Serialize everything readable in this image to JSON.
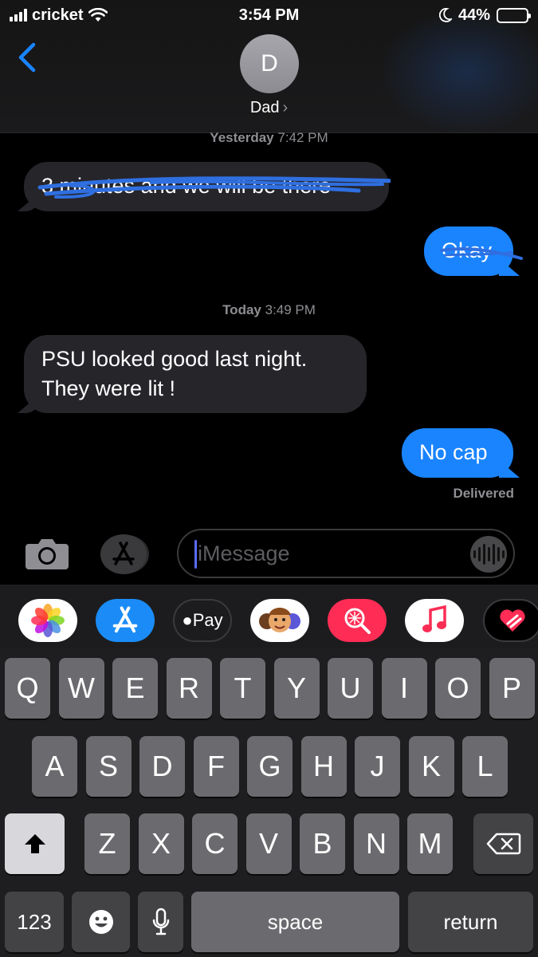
{
  "status_bar": {
    "carrier": "cricket",
    "time": "3:54 PM",
    "battery": "44%"
  },
  "header": {
    "avatar_initial": "D",
    "contact_name": "Dad",
    "chevron": "›"
  },
  "conversation": {
    "timestamps": [
      {
        "day": "Yesterday",
        "time": "7:42 PM"
      },
      {
        "day": "Today",
        "time": "3:49 PM"
      }
    ],
    "messages": [
      {
        "direction": "received",
        "text": "3 minutes and we will be there"
      },
      {
        "direction": "sent",
        "text": "Okay"
      },
      {
        "direction": "received",
        "text": "PSU looked good last night. They were lit !"
      },
      {
        "direction": "sent",
        "text": "No cap"
      }
    ],
    "delivery_status": "Delivered"
  },
  "compose": {
    "placeholder": "iMessage"
  },
  "app_drawer": {
    "apps": [
      "photos-icon",
      "app-store-icon",
      "apple-pay-icon",
      "memoji-icon",
      "search-images-icon",
      "music-icon",
      "digital-touch-icon"
    ],
    "apple_pay_label": "Pay"
  },
  "keyboard": {
    "row1": [
      "Q",
      "W",
      "E",
      "R",
      "T",
      "Y",
      "U",
      "I",
      "O",
      "P"
    ],
    "row2": [
      "A",
      "S",
      "D",
      "F",
      "G",
      "H",
      "J",
      "K",
      "L"
    ],
    "row3": [
      "Z",
      "X",
      "C",
      "V",
      "B",
      "N",
      "M"
    ],
    "numbers_label": "123",
    "space_label": "space",
    "return_label": "return"
  },
  "colors": {
    "sent_bubble": "#1a84ff",
    "received_bubble": "#26252a",
    "ink_scribble": "#2f6fe0"
  }
}
